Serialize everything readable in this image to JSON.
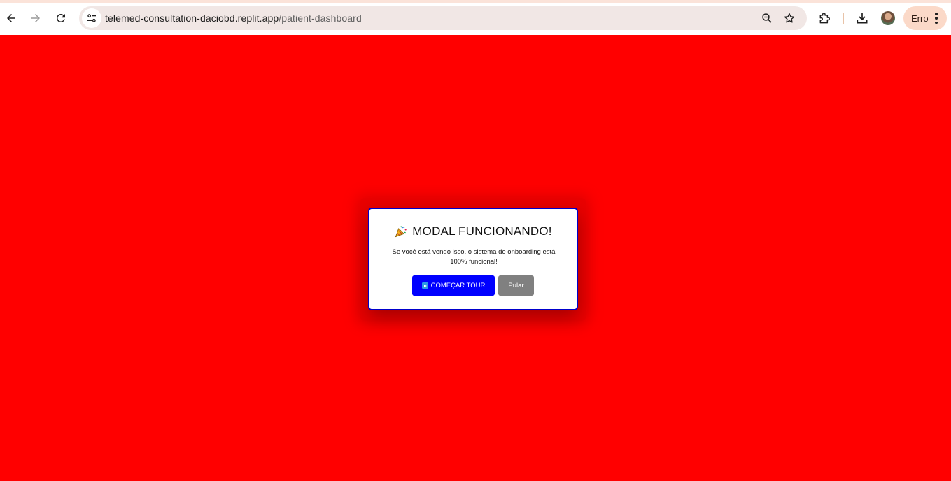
{
  "browser": {
    "url_host": "telemed-consultation-daciobd.replit.app",
    "url_path": "/patient-dashboard",
    "profile_chip_label": "Erro",
    "icons": {
      "back": "arrow-left-icon",
      "forward": "arrow-right-icon",
      "reload": "reload-icon",
      "site_info": "tune-icon",
      "zoom": "zoom-icon",
      "bookmark": "star-icon",
      "extensions": "puzzle-icon",
      "downloads": "download-icon",
      "menu": "kebab-menu-icon"
    },
    "colors": {
      "omnibox_bg": "#f1e7e5",
      "error_chip_bg": "#fbd9c8"
    }
  },
  "page": {
    "background_color": "#ff0000"
  },
  "modal": {
    "title_icon": "party-popper-icon",
    "title": "MODAL FUNCIONANDO!",
    "description": "Se você está vendo isso, o sistema de onboarding está 100% funcional!",
    "start_button_icon": "play-button-icon",
    "start_button_label": "COMEÇAR TOUR",
    "skip_button_label": "Pular",
    "colors": {
      "border": "#0000cc",
      "start_button_bg": "#0000ff",
      "skip_button_bg": "#808080"
    }
  }
}
